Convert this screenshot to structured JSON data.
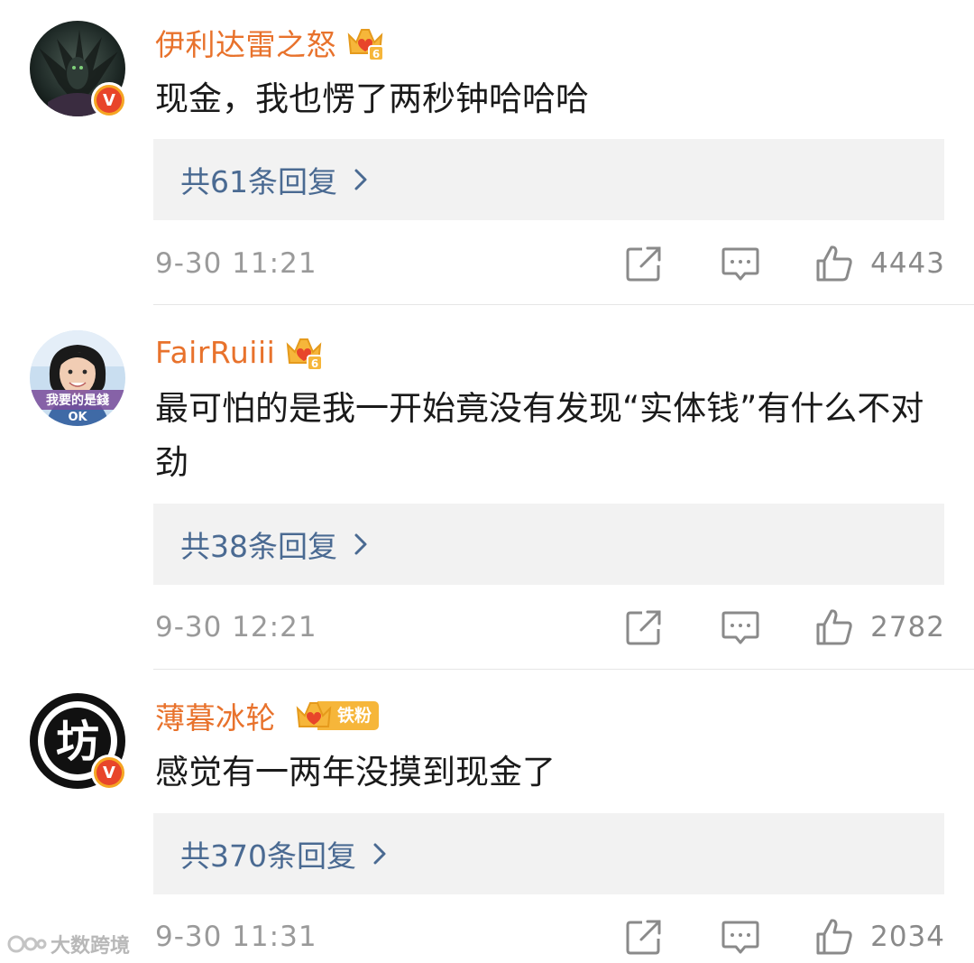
{
  "comments": [
    {
      "username": "伊利达雷之怒",
      "badge_level": "6",
      "fan_label": "",
      "text": "现金，我也愣了两秒钟哈哈哈",
      "replies_label": "共61条回复",
      "time": "9-30 11:21",
      "likes": "4443",
      "verified": true,
      "avatar_desc": "dark-winged-figure"
    },
    {
      "username": "FairRuiii",
      "badge_level": "6",
      "fan_label": "",
      "text": "最可怕的是我一开始竟没有发现“实体钱”有什么不对劲",
      "replies_label": "共38条回复",
      "time": "9-30 12:21",
      "likes": "2782",
      "verified": false,
      "avatar_caption": "我要的是錢",
      "avatar_caption2": "OK"
    },
    {
      "username": "薄暮冰轮",
      "badge_level": "",
      "fan_label": "铁粉",
      "text": "感觉有一两年没摸到现金了",
      "replies_label": "共370条回复",
      "time": "9-30 11:31",
      "likes": "2034",
      "verified": true,
      "avatar_char": "坊"
    }
  ],
  "watermark": "大数跨境",
  "colors": {
    "username": "#e8722c",
    "reply_link": "#4a6a92",
    "reply_bg": "#f2f2f2",
    "meta_gray": "#9a9a9a",
    "crown": "#f6b63a"
  },
  "icons": [
    "share-icon",
    "comment-icon",
    "like-icon",
    "chevron-right-icon",
    "crown-icon",
    "verified-v-icon"
  ]
}
